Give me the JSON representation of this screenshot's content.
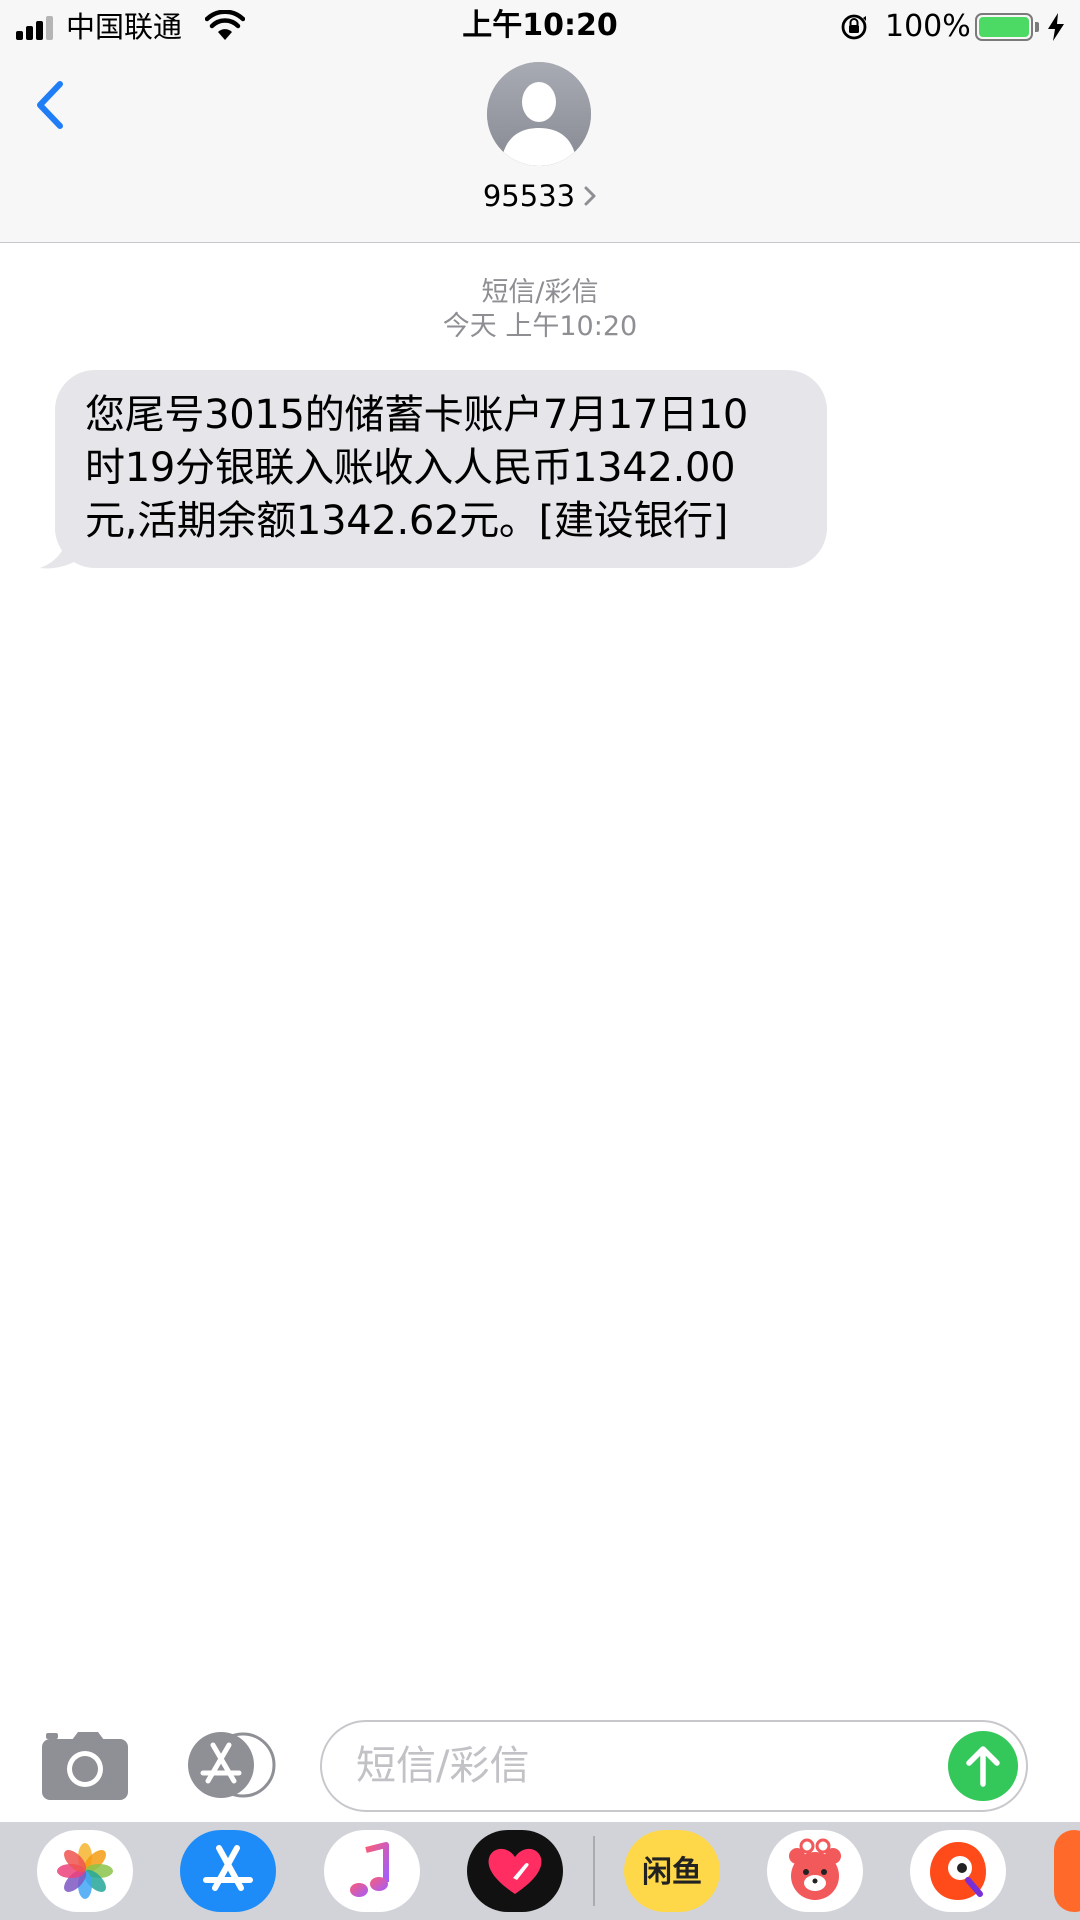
{
  "status_bar": {
    "carrier": "中国联通",
    "time": "上午10:20",
    "battery_percent": "100%",
    "battery_level": 1.0
  },
  "header": {
    "contact": "95533"
  },
  "conversation": {
    "type_label": "短信/彩信",
    "timestamp": "今天 上午10:20",
    "message_lines": [
      "您尾号3015的储蓄卡账户7月17日10",
      "时19分银联入账收入人民币1342.00",
      "元,活期余额1342.62元。[建设银行]"
    ]
  },
  "compose": {
    "placeholder": "短信/彩信"
  },
  "app_drawer": {
    "apps": [
      "photos-icon",
      "app-store-icon",
      "music-icon",
      "digital-touch-icon",
      "xianyu-icon",
      "bear-sticker-icon",
      "search-bird-icon",
      "partial-app-icon"
    ],
    "label_xianyu": "闲鱼"
  },
  "colors": {
    "accent_blue": "#1f7ef6",
    "bubble_gray": "#e5e5ea",
    "send_green": "#34c759",
    "secondary_text": "#8e8e93",
    "drawer_bg": "#d1d3d9"
  }
}
